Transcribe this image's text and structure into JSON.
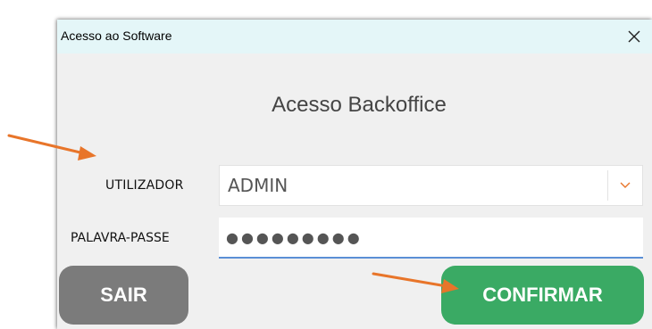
{
  "window": {
    "title": "Acesso ao Software",
    "close_symbol": "✕"
  },
  "form": {
    "heading": "Acesso Backoffice",
    "user_label": "UTILIZADOR",
    "user_value": "ADMIN",
    "password_label": "PALAVRA-PASSE",
    "password_value": "●●●●●●●●●"
  },
  "buttons": {
    "exit_label": "SAIR",
    "confirm_label": "CONFIRMAR"
  },
  "icons": {
    "combo_arrow": "chevron-down-icon",
    "close": "close-icon",
    "annotation": "arrow-icon"
  },
  "colors": {
    "titlebar": "#e4f6f8",
    "dialog_bg": "#f0f0f0",
    "exit_button": "#7b7b7b",
    "confirm_button": "#3aaa64",
    "annotation_arrow": "#e8752a",
    "focus_underline": "#5b8fd6"
  }
}
